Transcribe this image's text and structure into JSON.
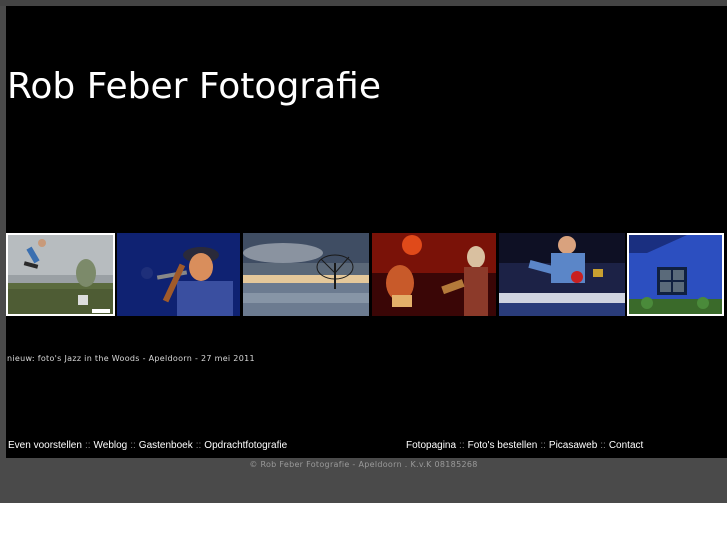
{
  "header": {
    "title": "Rob Feber Fotografie"
  },
  "photos": [
    {
      "icon": "skateboarder-photo"
    },
    {
      "icon": "singer-microphone-photo"
    },
    {
      "icon": "flooded-landscape-tree-photo"
    },
    {
      "icon": "guitar-concert-photo"
    },
    {
      "icon": "table-tennis-player-photo"
    },
    {
      "icon": "blue-house-photo"
    }
  ],
  "news": {
    "text": "nieuw: foto's Jazz in the Woods - Apeldoorn - 27 mei 2011"
  },
  "nav_left": {
    "items": [
      "Even voorstellen",
      "Weblog",
      "Gastenboek",
      "Opdrachtfotografie"
    ],
    "separator": "::"
  },
  "nav_right": {
    "items": [
      "Fotopagina",
      "Foto's bestellen",
      "Picasaweb",
      "Contact"
    ],
    "separator": "::"
  },
  "footer": {
    "text": "© Rob Feber Fotografie - Apeldoorn .  K.v.K 08185268"
  }
}
